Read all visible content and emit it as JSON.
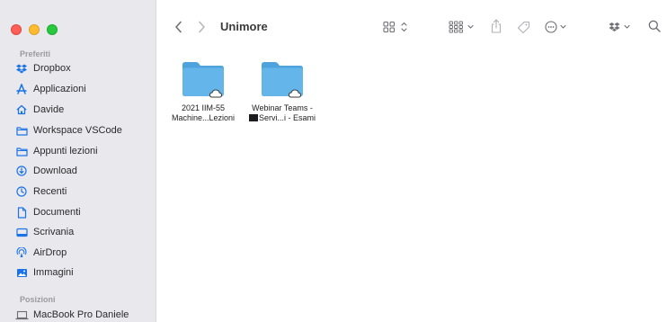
{
  "window": {
    "title": "Unimore"
  },
  "sidebar": {
    "favorites_title": "Preferiti",
    "favorites": [
      {
        "label": "Dropbox",
        "icon": "dropbox-icon"
      },
      {
        "label": "Applicazioni",
        "icon": "applications-icon"
      },
      {
        "label": "Davide",
        "icon": "home-icon"
      },
      {
        "label": "Workspace VSCode",
        "icon": "folder-icon"
      },
      {
        "label": "Appunti lezioni",
        "icon": "folder-icon"
      },
      {
        "label": "Download",
        "icon": "download-icon"
      },
      {
        "label": "Recenti",
        "icon": "clock-icon"
      },
      {
        "label": "Documenti",
        "icon": "document-icon"
      },
      {
        "label": "Scrivania",
        "icon": "desktop-icon"
      },
      {
        "label": "AirDrop",
        "icon": "airdrop-icon"
      },
      {
        "label": "Immagini",
        "icon": "photo-icon"
      }
    ],
    "locations_title": "Posizioni",
    "locations": [
      {
        "label": "MacBook Pro Daniele",
        "icon": "laptop-icon"
      }
    ]
  },
  "files": [
    {
      "line1": "2021 IIM-55",
      "line2": "Machine...Lezioni",
      "icon": "cloud-folder-icon"
    },
    {
      "line1": "Webinar Teams -",
      "line2": "Servi...i - Esami",
      "icon": "cloud-folder-icon"
    }
  ],
  "colors": {
    "accent": "#1a73e8",
    "folder": "#5fb2e8",
    "sidebar_bg": "#e9e8ec"
  }
}
